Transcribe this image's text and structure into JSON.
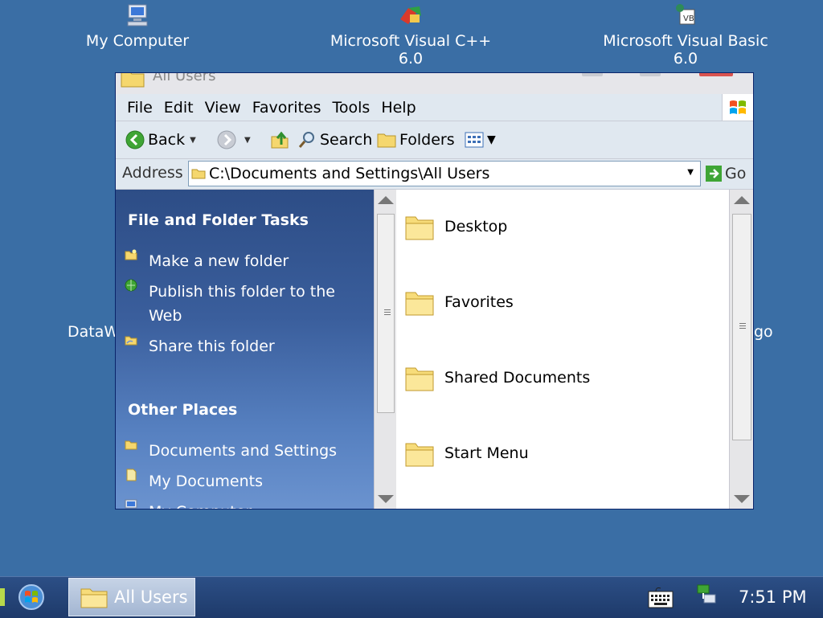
{
  "desktop": {
    "icons": [
      {
        "label": "My Computer",
        "icon": "my-computer-icon"
      },
      {
        "label": "Microsoft Visual C++ 6.0",
        "icon": "visual-cpp-icon"
      },
      {
        "label": "Microsoft Visual Basic 6.0",
        "icon": "visual-basic-icon"
      }
    ],
    "partial_left": "DataW",
    "partial_right": "go"
  },
  "window": {
    "title": "All Users",
    "menu": [
      "File",
      "Edit",
      "View",
      "Favorites",
      "Tools",
      "Help"
    ],
    "toolbar": {
      "back": "Back",
      "search": "Search",
      "folders": "Folders"
    },
    "address": {
      "label": "Address",
      "value": "C:\\Documents and Settings\\All Users",
      "go": "Go"
    },
    "taskpane": {
      "file_tasks_heading": "File and Folder Tasks",
      "file_tasks": [
        {
          "label": "Make a new folder",
          "icon": "new-folder-icon"
        },
        {
          "label": "Publish this folder to the Web",
          "icon": "publish-web-icon"
        },
        {
          "label": "Share this folder",
          "icon": "share-folder-icon"
        }
      ],
      "other_places_heading": "Other Places",
      "other_places": [
        {
          "label": "Documents and Settings",
          "icon": "folder-icon"
        },
        {
          "label": "My Documents",
          "icon": "my-documents-icon"
        },
        {
          "label": "My Computer",
          "icon": "my-computer-icon"
        }
      ]
    },
    "files": [
      {
        "name": "Desktop",
        "icon": "folder-icon"
      },
      {
        "name": "Favorites",
        "icon": "folder-icon"
      },
      {
        "name": "Shared Documents",
        "icon": "folder-icon"
      },
      {
        "name": "Start Menu",
        "icon": "folder-icon"
      }
    ]
  },
  "taskbar": {
    "task_label": "All Users",
    "clock": "7:51 PM"
  },
  "colors": {
    "desktop": "#3a6ea5",
    "taskpane": "#2d4d86",
    "taskbar": "#1e3a6a"
  }
}
